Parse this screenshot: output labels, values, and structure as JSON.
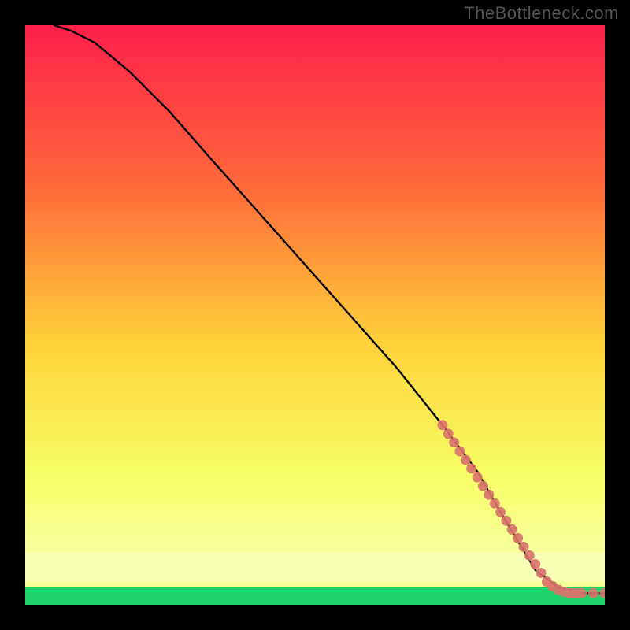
{
  "watermark": "TheBottleneck.com",
  "chart_data": {
    "type": "line",
    "title": "",
    "xlabel": "",
    "ylabel": "",
    "xlim": [
      0,
      100
    ],
    "ylim": [
      0,
      100
    ],
    "grid": false,
    "background_gradient": {
      "top": "#ff1f4b",
      "mid_upper": "#ff6a3a",
      "mid": "#ffd23a",
      "mid_lower": "#f7ff66",
      "band": "#f7ff9a",
      "bottom": "#1fd36a"
    },
    "series": [
      {
        "name": "curve",
        "type": "line",
        "color": "#000000",
        "x": [
          5,
          8,
          12,
          18,
          25,
          32,
          40,
          48,
          56,
          64,
          72,
          78,
          82,
          85,
          88,
          92,
          96,
          100
        ],
        "y": [
          100,
          99,
          97,
          92,
          85,
          77,
          68,
          59,
          50,
          41,
          31,
          23,
          16,
          11,
          6,
          3,
          2,
          2
        ]
      },
      {
        "name": "dots",
        "type": "scatter",
        "color": "#d9746b",
        "x": [
          72,
          73,
          74,
          75,
          76,
          77,
          78,
          79,
          80,
          81,
          82,
          83,
          84,
          85,
          86,
          87,
          88,
          89,
          90,
          91,
          92,
          93,
          94,
          95,
          96,
          98,
          100
        ],
        "y": [
          31,
          29.5,
          28,
          26.5,
          25,
          23.5,
          22,
          20.5,
          19,
          17.5,
          16,
          14.5,
          13,
          11.5,
          10,
          8.5,
          7,
          5.5,
          4,
          3.2,
          2.6,
          2.2,
          2,
          2,
          2,
          2,
          2
        ]
      }
    ]
  }
}
